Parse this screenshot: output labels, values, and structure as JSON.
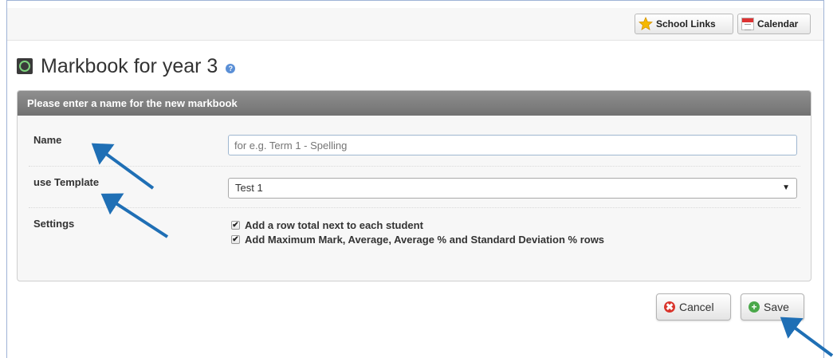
{
  "toolbar": {
    "school_links_label": "School Links",
    "calendar_label": "Calendar"
  },
  "page": {
    "title": "Markbook for year 3"
  },
  "panel": {
    "heading": "Please enter a name for the new markbook"
  },
  "form": {
    "name_label": "Name",
    "name_placeholder": "for e.g. Term 1 - Spelling",
    "template_label": "use Template",
    "template_selected": "Test 1",
    "settings_label": "Settings",
    "option_row_total": "Add a row total next to each student",
    "option_stats_rows": "Add Maximum Mark, Average, Average % and Standard Deviation % rows"
  },
  "actions": {
    "cancel_label": "Cancel",
    "save_label": "Save"
  },
  "colors": {
    "annotation_arrow": "#1f6fb5",
    "panel_header": "#7f7f7f",
    "cancel_icon": "#d9342b",
    "save_icon": "#4aa84a"
  }
}
